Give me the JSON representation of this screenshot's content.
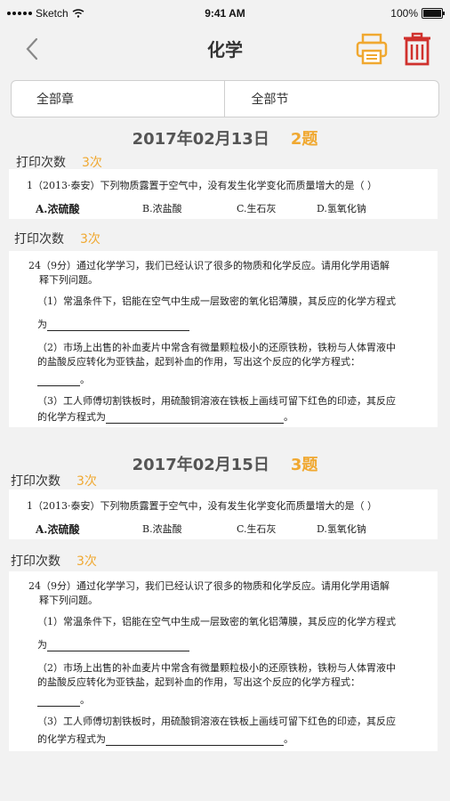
{
  "status_bar": {
    "carrier": "Sketch",
    "time": "9:41 AM",
    "battery": "100%"
  },
  "nav": {
    "title": "化学"
  },
  "filter": {
    "chapter": "全部章",
    "section": "全部节"
  },
  "colors": {
    "accent": "#f0a830",
    "danger": "#d0312d"
  },
  "groups": [
    {
      "date": "2017年02月13日",
      "count": "2题",
      "questions": [
        {
          "print_label": "打印次数",
          "print_count": "3次",
          "stem": "1（2013·泰安）下列物质露置于空气中，没有发生化学变化而质量增大的是（    ）",
          "options": [
            "A.浓硫酸",
            "B.浓盐酸",
            "C.生石灰",
            "D.氢氧化钠"
          ]
        },
        {
          "print_label": "打印次数",
          "print_count": "3次",
          "lines": [
            "24（9分）通过化学学习，我们已经认识了很多的物质和化学反应。请用化学用语解",
            "释下列问题。",
            "（1）常温条件下，铝能在空气中生成一层致密的氧化铝薄膜，其反应的化学方程式",
            "为",
            "（2）市场上出售的补血麦片中常含有微量颗粒极小的还原铁粉，铁粉与人体胃液中",
            "的盐酸反应转化为亚铁盐，起到补血的作用，写出这个反应的化学方程式：",
            "。",
            "（3）工人师傅切割铁板时，用硫酸铜溶液在铁板上画线可留下红色的印迹，其反应",
            "的化学方程式为",
            "。"
          ]
        }
      ]
    },
    {
      "date": "2017年02月15日",
      "count": "3题",
      "questions": [
        {
          "print_label": "打印次数",
          "print_count": "3次",
          "stem": "1（2013·泰安）下列物质露置于空气中，没有发生化学变化而质量增大的是（    ）",
          "options": [
            "A.浓硫酸",
            "B.浓盐酸",
            "C.生石灰",
            "D.氢氧化钠"
          ]
        },
        {
          "print_label": "打印次数",
          "print_count": "3次",
          "lines": [
            "24（9分）通过化学学习，我们已经认识了很多的物质和化学反应。请用化学用语解",
            "释下列问题。",
            "（1）常温条件下，铝能在空气中生成一层致密的氧化铝薄膜，其反应的化学方程式",
            "为",
            "（2）市场上出售的补血麦片中常含有微量颗粒极小的还原铁粉，铁粉与人体胃液中",
            "的盐酸反应转化为亚铁盐，起到补血的作用，写出这个反应的化学方程式：",
            "。",
            "（3）工人师傅切割铁板时，用硫酸铜溶液在铁板上画线可留下红色的印迹，其反应",
            "的化学方程式为",
            "。"
          ]
        }
      ]
    }
  ]
}
